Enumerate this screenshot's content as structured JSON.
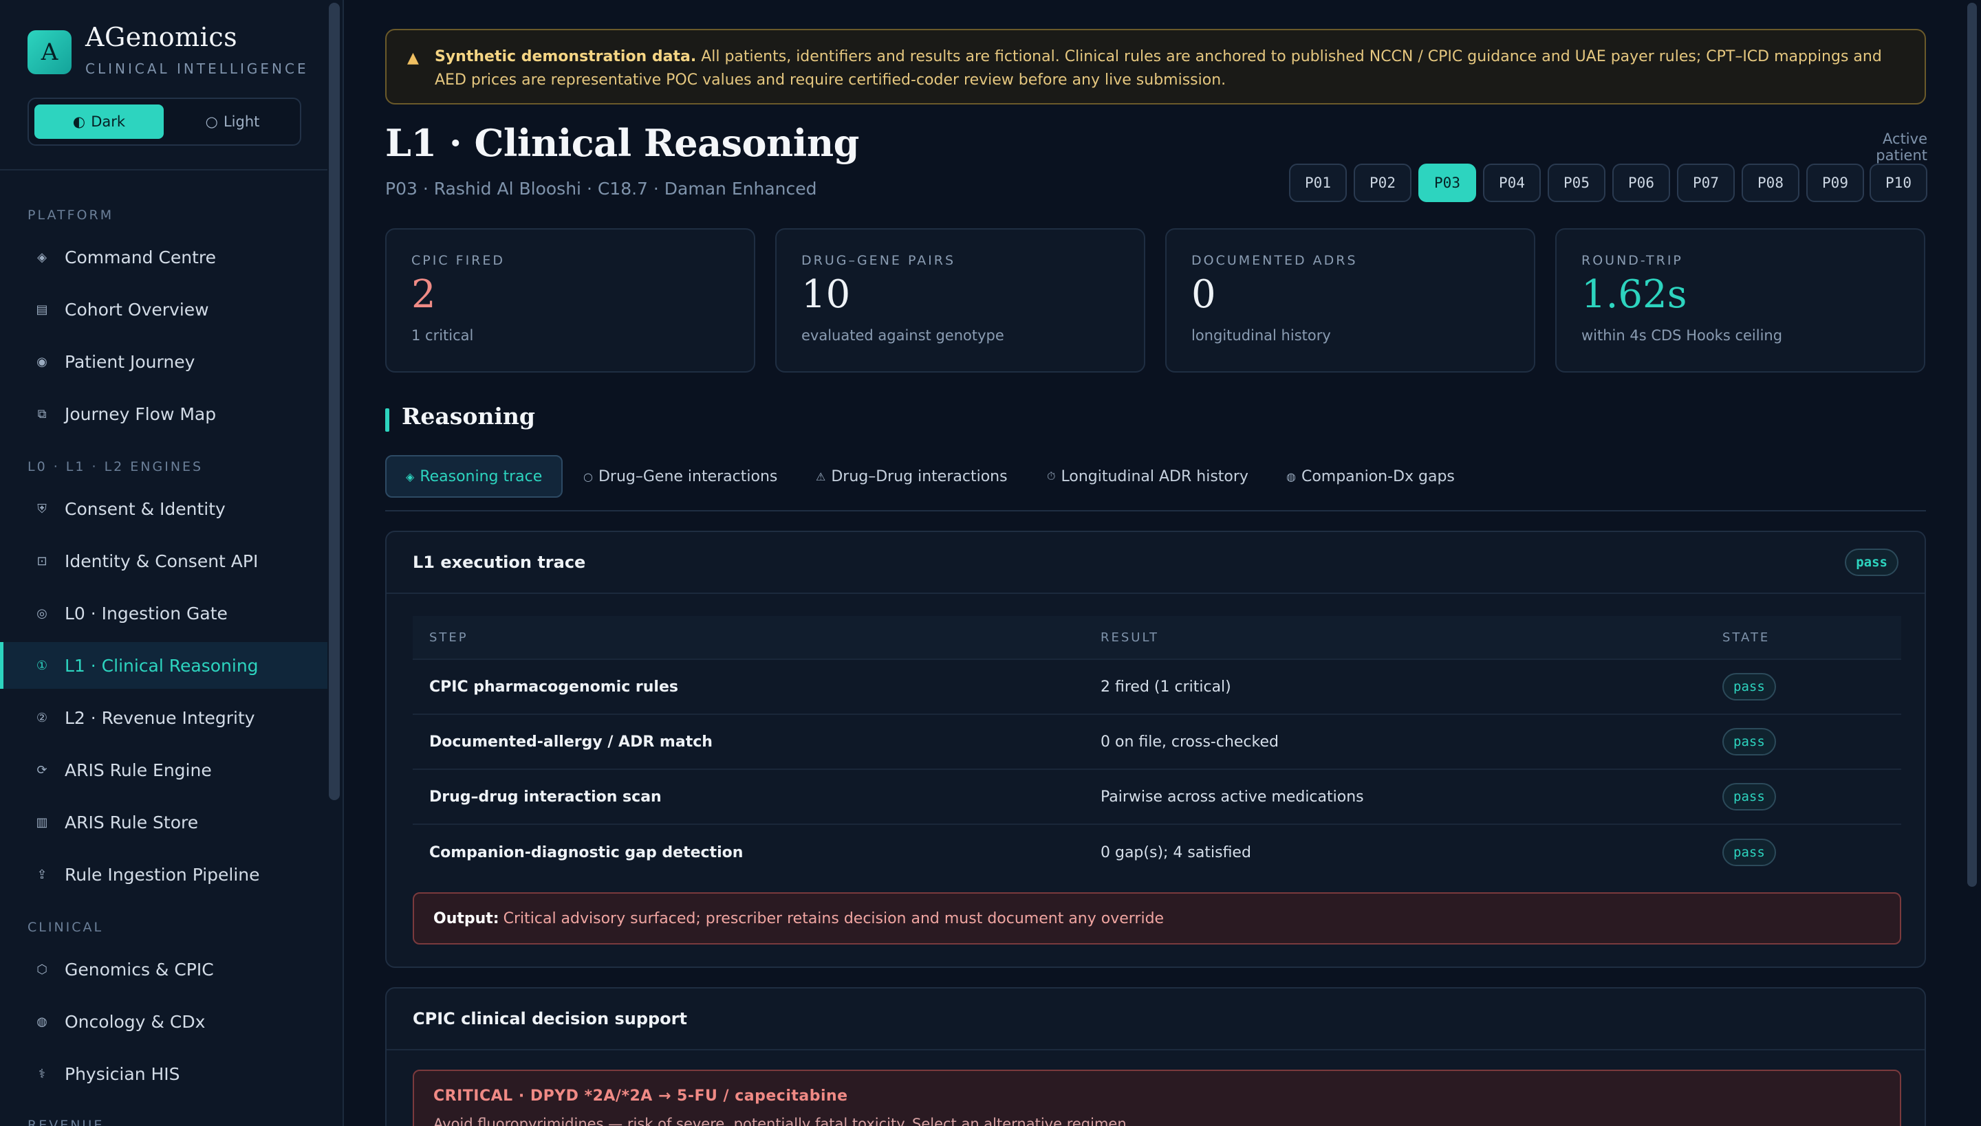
{
  "brand": {
    "logo_letter": "A",
    "name": "AGenomics",
    "subtitle": "CLINICAL INTELLIGENCE"
  },
  "theme": {
    "dark_label": "Dark",
    "light_label": "Light",
    "selected": "Dark"
  },
  "sidebar": {
    "sections": [
      "PLATFORM",
      "L0 · L1 · L2 ENGINES",
      "CLINICAL",
      "REVENUE"
    ],
    "items": [
      {
        "label": "Command Centre",
        "icon": "diamond-icon"
      },
      {
        "label": "Cohort Overview",
        "icon": "grid-icon"
      },
      {
        "label": "Patient Journey",
        "icon": "circle-dot-icon"
      },
      {
        "label": "Journey Flow Map",
        "icon": "map-icon"
      },
      {
        "label": "Consent & Identity",
        "icon": "shield-icon"
      },
      {
        "label": "Identity & Consent API",
        "icon": "api-icon"
      },
      {
        "label": "L0 · Ingestion Gate",
        "icon": "target-icon"
      },
      {
        "label": "L1 · Clinical Reasoning",
        "icon": "l1-icon"
      },
      {
        "label": "L2 · Revenue Integrity",
        "icon": "l2-icon"
      },
      {
        "label": "ARIS Rule Engine",
        "icon": "engine-icon"
      },
      {
        "label": "ARIS Rule Store",
        "icon": "store-icon"
      },
      {
        "label": "Rule Ingestion Pipeline",
        "icon": "upload-icon"
      },
      {
        "label": "Genomics & CPIC",
        "icon": "hexagon-icon"
      },
      {
        "label": "Oncology & CDx",
        "icon": "dot-icon"
      },
      {
        "label": "Physician HIS",
        "icon": "caduceus-icon"
      }
    ],
    "active": "L1 · Clinical Reasoning"
  },
  "banner": {
    "title": "Synthetic demonstration data.",
    "text": "All patients, identifiers and results are fictional. Clinical rules are anchored to published NCCN / CPIC guidance and UAE payer rules; CPT–ICD mappings and AED prices are representative POC values and require certified-coder review before any live submission."
  },
  "page": {
    "title": "L1 · Clinical Reasoning",
    "subtitle": "P03 · Rashid Al Blooshi · C18.7 · Daman Enhanced",
    "active_patient_label": "Active patient",
    "patients": [
      "P01",
      "P02",
      "P03",
      "P04",
      "P05",
      "P06",
      "P07",
      "P08",
      "P09",
      "P10"
    ],
    "selected_patient": "P03"
  },
  "stats": [
    {
      "label": "CPIC FIRED",
      "value": "2",
      "note": "1 critical",
      "tone": "red"
    },
    {
      "label": "DRUG–GENE PAIRS",
      "value": "10",
      "note": "evaluated against genotype",
      "tone": "default"
    },
    {
      "label": "DOCUMENTED ADRS",
      "value": "0",
      "note": "longitudinal history",
      "tone": "default"
    },
    {
      "label": "ROUND-TRIP",
      "value": "1.62s",
      "note": "within 4s CDS Hooks ceiling",
      "tone": "teal"
    }
  ],
  "reasoning": {
    "section_title": "Reasoning",
    "tabs": [
      {
        "label": "Reasoning trace",
        "icon": "◈"
      },
      {
        "label": "Drug–Gene interactions",
        "icon": "○"
      },
      {
        "label": "Drug–Drug interactions",
        "icon": "⚠"
      },
      {
        "label": "Longitudinal ADR history",
        "icon": "⏱"
      },
      {
        "label": "Companion-Dx gaps",
        "icon": "◍"
      }
    ],
    "active_tab": "Reasoning trace"
  },
  "trace": {
    "title": "L1 execution trace",
    "status": "pass",
    "columns": [
      "STEP",
      "RESULT",
      "STATE"
    ],
    "rows": [
      {
        "step": "CPIC pharmacogenomic rules",
        "result": "2 fired (1 critical)",
        "state": "pass"
      },
      {
        "step": "Documented-allergy / ADR match",
        "result": "0 on file, cross-checked",
        "state": "pass"
      },
      {
        "step": "Drug–drug interaction scan",
        "result": "Pairwise across active medications",
        "state": "pass"
      },
      {
        "step": "Companion-diagnostic gap detection",
        "result": "0 gap(s); 4 satisfied",
        "state": "pass"
      }
    ],
    "output_label": "Output:",
    "output_text": "Critical advisory surfaced; prescriber retains decision and must document any override"
  },
  "cds": {
    "title": "CPIC clinical decision support",
    "alert_title": "CRITICAL · DPYD *2A/*2A → 5-FU / capecitabine",
    "alert_body": "Avoid fluoropyrimidines — risk of severe, potentially fatal toxicity. Select an alternative regimen."
  },
  "colors": {
    "accent": "#2dd4bf",
    "critical": "#ef8b86",
    "warning": "#e5c77f",
    "background": "#0a1220"
  }
}
